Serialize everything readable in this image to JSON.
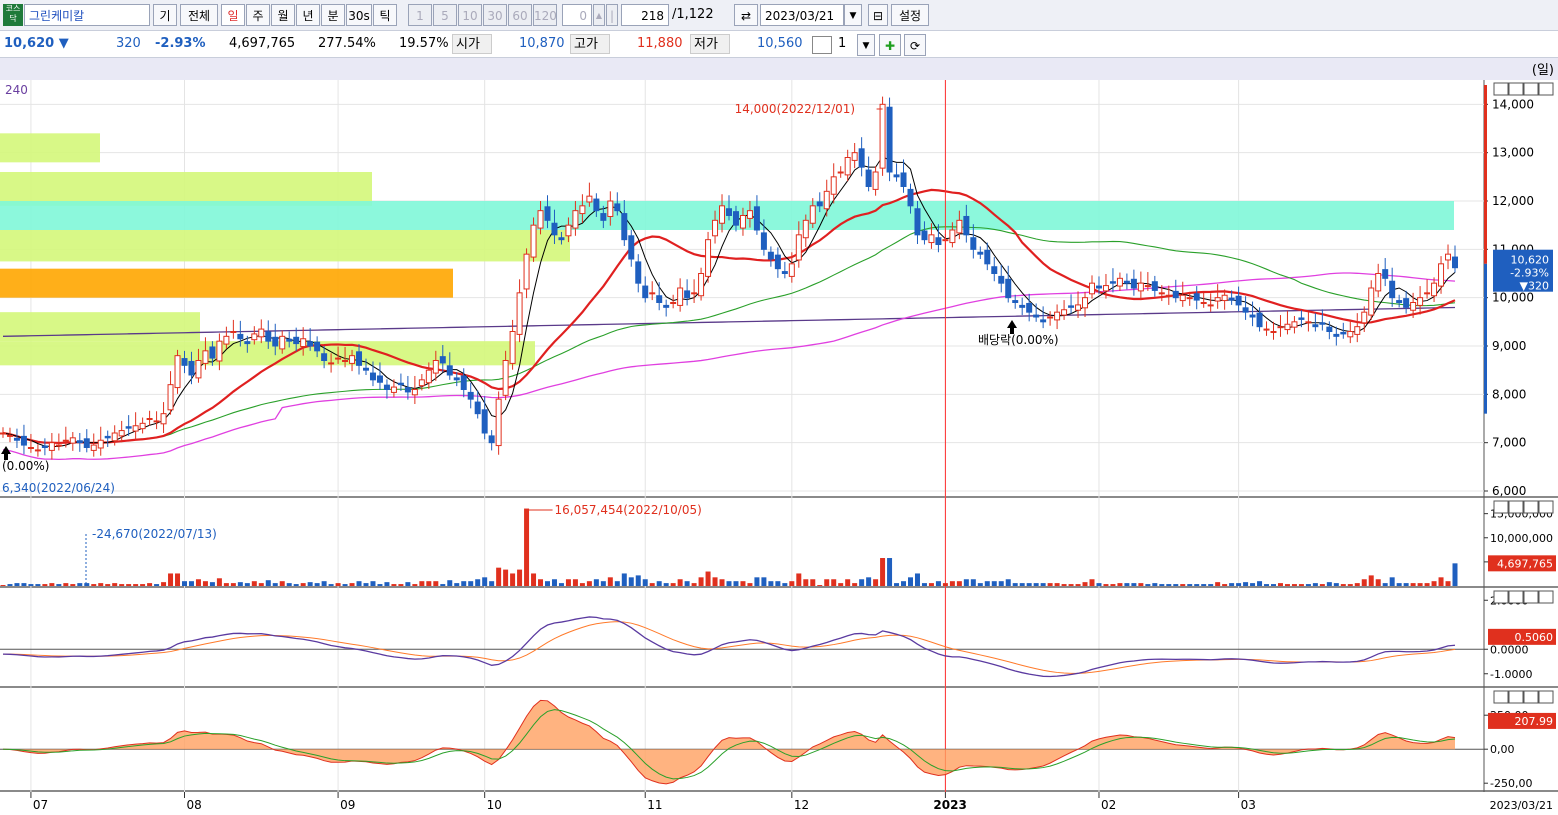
{
  "toolbar": {
    "stock_icon": "코스닥",
    "stock_name": "그린케미칼",
    "btn_gi": "기",
    "btn_all": "전체",
    "periods": [
      "일",
      "주",
      "월",
      "년",
      "분",
      "30s",
      "틱"
    ],
    "selected_period": "일",
    "intervals": [
      "1",
      "5",
      "10",
      "30",
      "60",
      "120"
    ],
    "interval_value": "0",
    "count": "218",
    "total": "/1,122",
    "date": "2023/03/21",
    "settings": "설정"
  },
  "quote": {
    "price": "10,620 ▼",
    "change": "320",
    "change_pct": "-2.93%",
    "volume": "4,697,765",
    "vol_ratio": "277.54%",
    "turnover": "19.57%",
    "open_label": "시가",
    "open": "10,870",
    "high_label": "고가",
    "high": "11,880",
    "low_label": "저가",
    "low": "10,560",
    "mult": "1"
  },
  "chart_header": {
    "unit": "(일)",
    "ma_label": "240"
  },
  "colors": {
    "up": "#e0301e",
    "down": "#1f5fbf",
    "ma5": "#000000",
    "ma20": "#e02020",
    "ma60": "#2aa02a",
    "ma120": "#e040e0",
    "ma240": "#5a3a8a",
    "box_green": "#d4f77a",
    "box_cyan": "#7ff7d8",
    "box_orange": "#ffa600"
  },
  "chart_data": [
    {
      "type": "candlestick",
      "x_ticks": [
        "07",
        "08",
        "09",
        "10",
        "11",
        "12",
        "2023",
        "02",
        "03"
      ],
      "y_ticks": [
        "6,000",
        "7,000",
        "8,000",
        "9,000",
        "10,000",
        "11,000",
        "12,000",
        "13,000",
        "14,000"
      ],
      "ylim": [
        6000,
        14400
      ],
      "start_date": "2022/06/24",
      "end_date": "2023/03/21",
      "closes": [
        7200,
        7150,
        7050,
        6950,
        6900,
        6850,
        6900,
        7000,
        6950,
        7050,
        7100,
        7000,
        6900,
        6950,
        7050,
        7100,
        7200,
        7250,
        7300,
        7350,
        7400,
        7500,
        7450,
        7600,
        8200,
        8800,
        8600,
        8400,
        8700,
        8900,
        8750,
        9100,
        9200,
        9300,
        9150,
        9050,
        9250,
        9350,
        9100,
        9000,
        9200,
        9100,
        9050,
        9150,
        9000,
        8900,
        8700,
        8650,
        8750,
        8700,
        8800,
        8600,
        8500,
        8300,
        8250,
        8100,
        8150,
        8200,
        8050,
        8100,
        8300,
        8500,
        8700,
        8650,
        8400,
        8300,
        8100,
        7900,
        7600,
        7200,
        7000,
        7900,
        8700,
        9300,
        10100,
        10900,
        11500,
        11800,
        11600,
        11300,
        11200,
        11500,
        11800,
        11900,
        12100,
        11800,
        11600,
        12000,
        11800,
        11200,
        10800,
        10300,
        10000,
        10100,
        9900,
        9800,
        9900,
        10200,
        10000,
        10100,
        10500,
        11200,
        11600,
        11900,
        11700,
        11500,
        11700,
        11800,
        11400,
        11000,
        10800,
        10600,
        10500,
        10700,
        11300,
        11600,
        11900,
        11900,
        12200,
        12500,
        12600,
        12900,
        13000,
        12700,
        12300,
        12600,
        14000,
        12600,
        12500,
        12300,
        11900,
        11300,
        11200,
        11300,
        11100,
        11200,
        11400,
        11600,
        11300,
        11000,
        10900,
        10700,
        10500,
        10300,
        10000,
        9900,
        9800,
        9700,
        9600,
        9500,
        9600,
        9700,
        9750,
        9800,
        9850,
        10000,
        10300,
        10200,
        10250,
        10300,
        10400,
        10300,
        10200,
        10300,
        10250,
        10150,
        10100,
        10050,
        10000,
        10050,
        10000,
        9950,
        9900,
        9850,
        10000,
        10050,
        9950,
        9850,
        9700,
        9600,
        9400,
        9350,
        9300,
        9400,
        9450,
        9500,
        9550,
        9500,
        9400,
        9450,
        9300,
        9200,
        9250,
        9300,
        9400,
        9700,
        10200,
        10500,
        10400,
        10000,
        9900,
        9800,
        9900,
        10000,
        10100,
        10300,
        10700,
        10900,
        10620
      ],
      "annotations": [
        "14,000(2022/12/01)",
        "6,340(2022/06/24)",
        "배당락(0.00%)",
        "(0.00%)"
      ],
      "last_price": [
        "10,620",
        "-2.93%",
        "▼320"
      ]
    },
    {
      "type": "bar",
      "name": "volume",
      "y_ticks": [
        "5,000,000",
        "10,000,000",
        "15,000,000"
      ],
      "ylim": [
        0,
        17000000
      ],
      "max_label": "16,057,454(2022/10/05)",
      "min_label": "-24,670(2022/07/13)",
      "last_value": "4,697,765"
    },
    {
      "type": "line",
      "name": "MACD",
      "y_ticks": [
        "2.0000",
        "0.0000",
        "-1.0000"
      ],
      "ylim": [
        -1.5,
        2.5
      ],
      "last_value": "0.5060"
    },
    {
      "type": "area",
      "name": "oscillator",
      "y_ticks": [
        "250,00",
        "0,00",
        "-250,00"
      ],
      "ylim": [
        -300,
        450
      ],
      "last_value": "207.99"
    }
  ],
  "x_axis_end_date": "2023/03/21",
  "marker_year": "2023"
}
